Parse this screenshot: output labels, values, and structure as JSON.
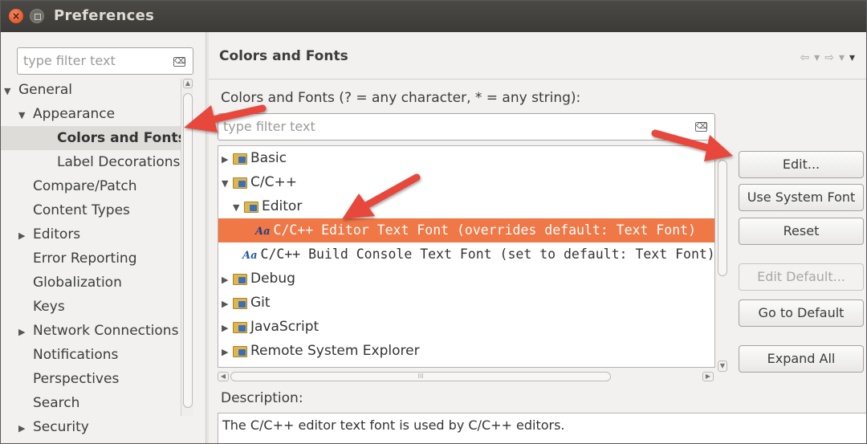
{
  "window": {
    "title": "Preferences",
    "close_glyph": "×"
  },
  "left": {
    "filter_placeholder": "type filter text",
    "items": [
      {
        "label": "General",
        "twisty": "▼",
        "level": 0
      },
      {
        "label": "Appearance",
        "twisty": "▼",
        "level": 1
      },
      {
        "label": "Colors and Fonts",
        "twisty": "",
        "level": 2,
        "selected": true
      },
      {
        "label": "Label Decorations",
        "twisty": "",
        "level": 2
      },
      {
        "label": "Compare/Patch",
        "twisty": "",
        "level": 1
      },
      {
        "label": "Content Types",
        "twisty": "",
        "level": 1
      },
      {
        "label": "Editors",
        "twisty": "▶",
        "level": 1
      },
      {
        "label": "Error Reporting",
        "twisty": "",
        "level": 1
      },
      {
        "label": "Globalization",
        "twisty": "",
        "level": 1
      },
      {
        "label": "Keys",
        "twisty": "",
        "level": 1
      },
      {
        "label": "Network Connections",
        "twisty": "▶",
        "level": 1
      },
      {
        "label": "Notifications",
        "twisty": "",
        "level": 1
      },
      {
        "label": "Perspectives",
        "twisty": "",
        "level": 1
      },
      {
        "label": "Search",
        "twisty": "",
        "level": 1
      },
      {
        "label": "Security",
        "twisty": "▶",
        "level": 1
      }
    ]
  },
  "main": {
    "page_title": "Colors and Fonts",
    "nav": {
      "back": "⇦",
      "dropdown": "▾",
      "forward": "⇨",
      "menu": "▾"
    },
    "filter_label": "Colors and Fonts (? = any character, * = any string):",
    "filter_placeholder": "type filter text",
    "tree": [
      {
        "label": "Basic",
        "twisty": "▶",
        "icon": "folder",
        "level": 0
      },
      {
        "label": "C/C++",
        "twisty": "▼",
        "icon": "folder",
        "level": 0
      },
      {
        "label": "Editor",
        "twisty": "▼",
        "icon": "folder",
        "level": 1
      },
      {
        "label": "C/C++ Editor Text Font (overrides default: Text Font)",
        "twisty": "",
        "icon": "font",
        "level": 2,
        "selected": true,
        "mono": true
      },
      {
        "label": "C/C++ Build Console Text Font (set to default: Text Font)",
        "twisty": "",
        "icon": "font",
        "level": 1,
        "mono": true
      },
      {
        "label": "Debug",
        "twisty": "▶",
        "icon": "folder",
        "level": 0
      },
      {
        "label": "Git",
        "twisty": "▶",
        "icon": "folder",
        "level": 0
      },
      {
        "label": "JavaScript",
        "twisty": "▶",
        "icon": "folder",
        "level": 0
      },
      {
        "label": "Remote System Explorer",
        "twisty": "▶",
        "icon": "folder",
        "level": 0
      }
    ],
    "font_icon_text": "Aa",
    "hscroll_grip": "III",
    "description_label": "Description:",
    "description_text": "The C/C++ editor text font is used by C/C++ editors.",
    "buttons": {
      "edit": "Edit...",
      "use_system_font": "Use System Font",
      "reset": "Reset",
      "edit_default": "Edit Default...",
      "go_to_default": "Go to Default",
      "expand_all": "Expand All"
    }
  },
  "annotation_color": "#e8473a"
}
